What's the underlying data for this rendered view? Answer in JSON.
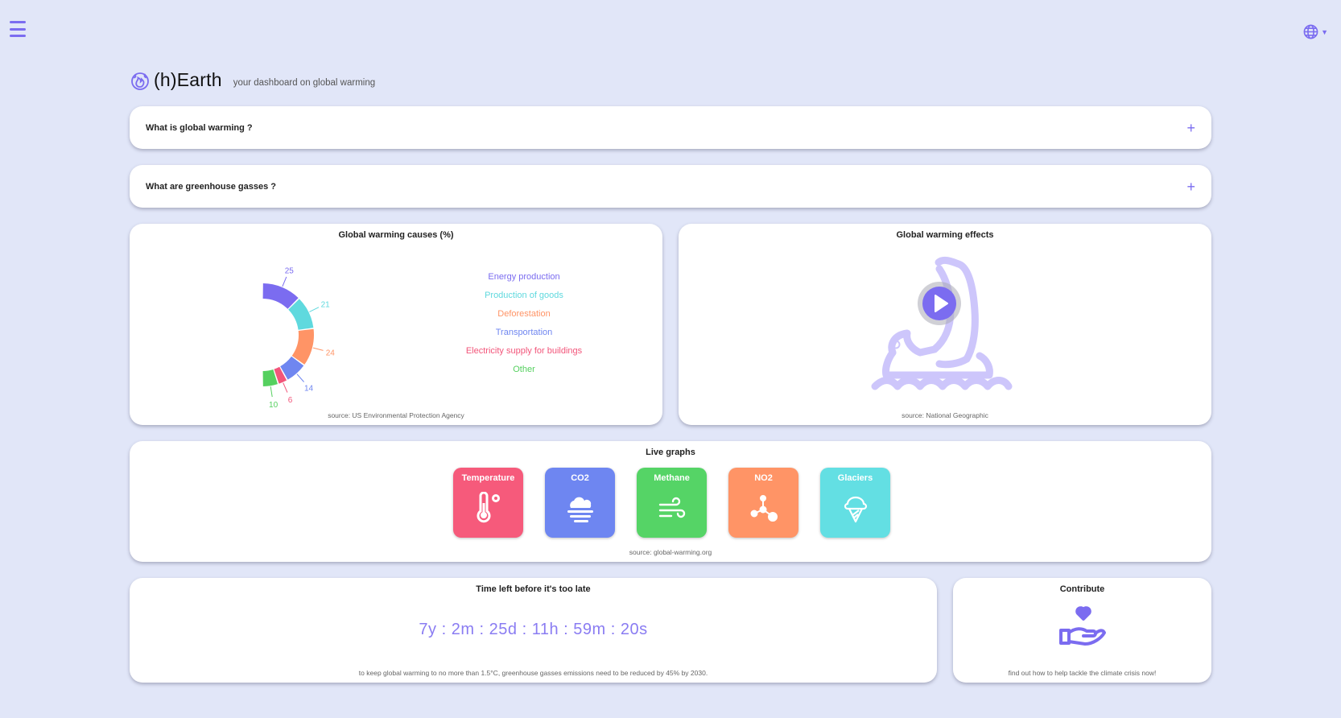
{
  "app": {
    "brand": "(h)Earth",
    "tagline": "your dashboard on global warming"
  },
  "faq": [
    {
      "question": "What is global warming ?",
      "toggle": "+"
    },
    {
      "question": "What are greenhouse gasses ?",
      "toggle": "+"
    }
  ],
  "causes": {
    "title": "Global warming causes (%)",
    "source": "source: US Environmental Protection Agency",
    "chart_data": {
      "type": "pie",
      "title": "Global warming causes (%)",
      "categories": [
        "Energy production",
        "Production of goods",
        "Deforestation",
        "Transportation",
        "Electricity supply for buildings",
        "Other"
      ],
      "values": [
        25,
        21,
        24,
        14,
        6,
        10
      ],
      "colors": [
        "#7b6cf0",
        "#5fd9de",
        "#ff9466",
        "#6f86f0",
        "#f2557a",
        "#55d05f"
      ],
      "labels": [
        "25",
        "21",
        "24",
        "14",
        "6",
        "10"
      ],
      "legend": "right"
    }
  },
  "effects": {
    "title": "Global warming effects",
    "source": "source: National Geographic",
    "icon": "polar-bear-icon"
  },
  "live": {
    "title": "Live graphs",
    "source": "source: global-warming.org",
    "tiles": [
      {
        "label": "Temperature",
        "color": "#f65a7b",
        "icon": "thermometer-icon"
      },
      {
        "label": "CO2",
        "color": "#6e86f1",
        "icon": "smog-icon"
      },
      {
        "label": "Methane",
        "color": "#55d466",
        "icon": "wind-icon"
      },
      {
        "label": "NO2",
        "color": "#ff9466",
        "icon": "molecule-icon"
      },
      {
        "label": "Glaciers",
        "color": "#63dfe3",
        "icon": "ice-cream-icon"
      }
    ]
  },
  "timer": {
    "title": "Time left before it's too late",
    "countdown": "7y : 2m : 25d : 11h : 59m : 20s",
    "note": "to keep global warming to no more than 1.5°C, greenhouse gasses emissions need to be reduced by 45% by 2030."
  },
  "contribute": {
    "title": "Contribute",
    "note": "find out how to help tackle the climate crisis now!",
    "icon": "hand-heart-icon"
  },
  "colors": {
    "accent": "#7b6cf0",
    "background": "#e1e6f8"
  }
}
